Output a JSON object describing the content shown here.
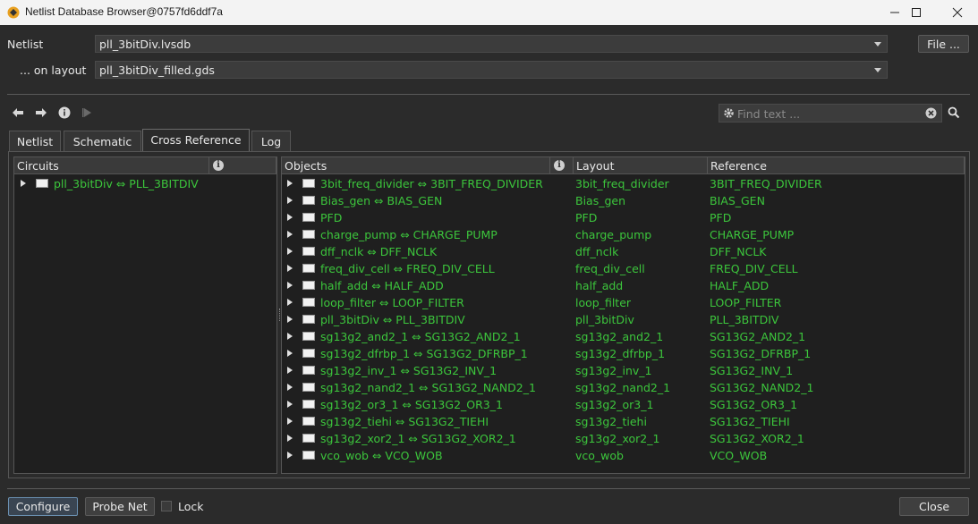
{
  "window": {
    "title": "Netlist Database Browser@0757fd6ddf7a",
    "minimize_icon": "minimize-icon",
    "maximize_icon": "maximize-icon",
    "close_icon": "close-icon"
  },
  "netlist_row": {
    "label": "Netlist",
    "value": "pll_3bitDiv.lvsdb",
    "file_button": "File ..."
  },
  "layout_row": {
    "label": "... on layout",
    "value": "pll_3bitDiv_filled.gds"
  },
  "search": {
    "placeholder": "Find text ..."
  },
  "tabs": [
    {
      "label": "Netlist"
    },
    {
      "label": "Schematic"
    },
    {
      "label": "Cross Reference",
      "active": true
    },
    {
      "label": "Log"
    }
  ],
  "circuits_panel": {
    "header": "Circuits",
    "items": [
      {
        "label": "pll_3bitDiv ⇔ PLL_3BITDIV"
      }
    ]
  },
  "objects_panel": {
    "headers": {
      "objects": "Objects",
      "layout": "Layout",
      "reference": "Reference"
    },
    "rows": [
      {
        "object": "3bit_freq_divider ⇔ 3BIT_FREQ_DIVIDER",
        "layout": "3bit_freq_divider",
        "reference": "3BIT_FREQ_DIVIDER"
      },
      {
        "object": "Bias_gen ⇔ BIAS_GEN",
        "layout": "Bias_gen",
        "reference": "BIAS_GEN"
      },
      {
        "object": "PFD",
        "layout": "PFD",
        "reference": "PFD"
      },
      {
        "object": "charge_pump ⇔ CHARGE_PUMP",
        "layout": "charge_pump",
        "reference": "CHARGE_PUMP"
      },
      {
        "object": "dff_nclk ⇔ DFF_NCLK",
        "layout": "dff_nclk",
        "reference": "DFF_NCLK"
      },
      {
        "object": "freq_div_cell ⇔ FREQ_DIV_CELL",
        "layout": "freq_div_cell",
        "reference": "FREQ_DIV_CELL"
      },
      {
        "object": "half_add ⇔ HALF_ADD",
        "layout": "half_add",
        "reference": "HALF_ADD"
      },
      {
        "object": "loop_filter ⇔ LOOP_FILTER",
        "layout": "loop_filter",
        "reference": "LOOP_FILTER"
      },
      {
        "object": "pll_3bitDiv ⇔ PLL_3BITDIV",
        "layout": "pll_3bitDiv",
        "reference": "PLL_3BITDIV"
      },
      {
        "object": "sg13g2_and2_1 ⇔ SG13G2_AND2_1",
        "layout": "sg13g2_and2_1",
        "reference": "SG13G2_AND2_1"
      },
      {
        "object": "sg13g2_dfrbp_1 ⇔ SG13G2_DFRBP_1",
        "layout": "sg13g2_dfrbp_1",
        "reference": "SG13G2_DFRBP_1"
      },
      {
        "object": "sg13g2_inv_1 ⇔ SG13G2_INV_1",
        "layout": "sg13g2_inv_1",
        "reference": "SG13G2_INV_1"
      },
      {
        "object": "sg13g2_nand2_1 ⇔ SG13G2_NAND2_1",
        "layout": "sg13g2_nand2_1",
        "reference": "SG13G2_NAND2_1"
      },
      {
        "object": "sg13g2_or3_1 ⇔ SG13G2_OR3_1",
        "layout": "sg13g2_or3_1",
        "reference": "SG13G2_OR3_1"
      },
      {
        "object": "sg13g2_tiehi ⇔ SG13G2_TIEHI",
        "layout": "sg13g2_tiehi",
        "reference": "SG13G2_TIEHI"
      },
      {
        "object": "sg13g2_xor2_1 ⇔ SG13G2_XOR2_1",
        "layout": "sg13g2_xor2_1",
        "reference": "SG13G2_XOR2_1"
      },
      {
        "object": "vco_wob ⇔ VCO_WOB",
        "layout": "vco_wob",
        "reference": "VCO_WOB"
      }
    ]
  },
  "footer": {
    "configure": "Configure",
    "probe_net": "Probe Net",
    "lock": "Lock",
    "close": "Close"
  },
  "colors": {
    "match_text": "#3cc63c",
    "background": "#2b2b2b",
    "list_background": "#1f1f1f"
  }
}
